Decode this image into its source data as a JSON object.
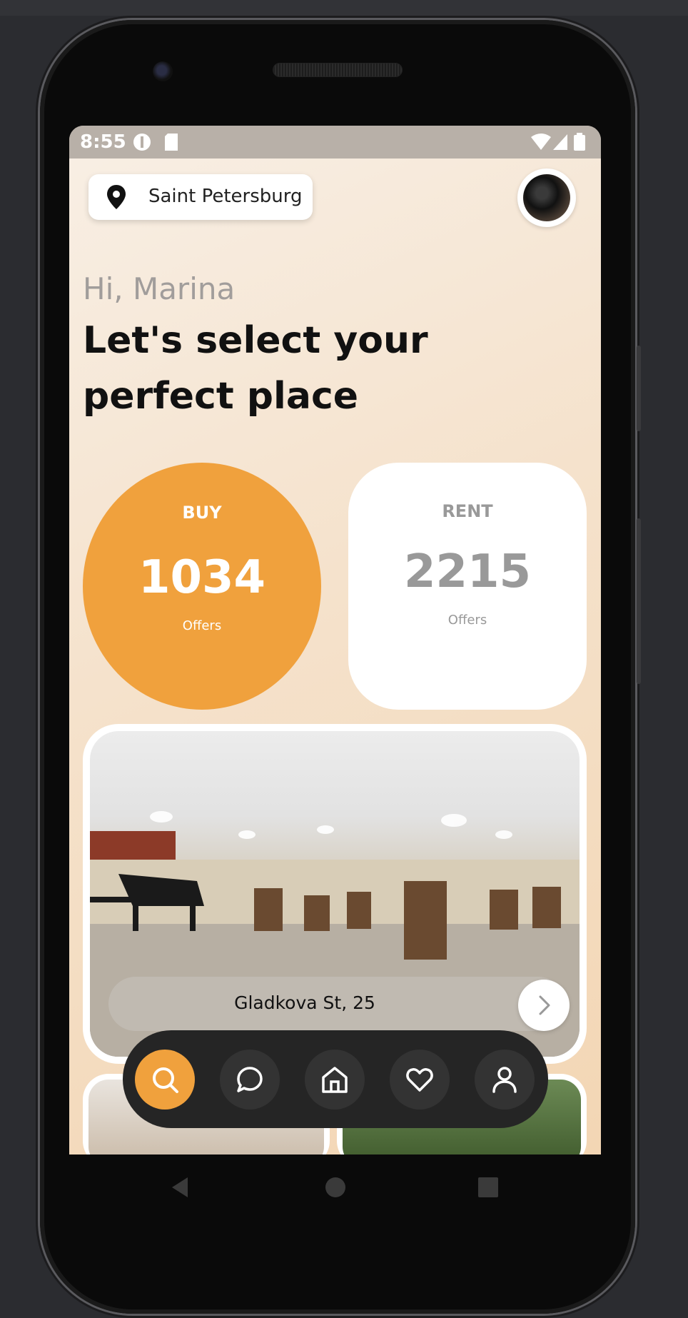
{
  "status_bar": {
    "time": "8:55"
  },
  "location": {
    "city": "Saint Petersburg"
  },
  "greeting": {
    "hello": "Hi, Marina",
    "headline": "Let's select your perfect place"
  },
  "cards": {
    "buy": {
      "label": "BUY",
      "count": "1034",
      "sub": "Offers"
    },
    "rent": {
      "label": "RENT",
      "count": "2215",
      "sub": "Offers"
    }
  },
  "listing": {
    "address": "Gladkova St, 25"
  },
  "bottom_nav": [
    {
      "name": "search-icon",
      "active": true
    },
    {
      "name": "chat-icon",
      "active": false
    },
    {
      "name": "home-icon",
      "active": false
    },
    {
      "name": "heart-icon",
      "active": false
    },
    {
      "name": "profile-icon",
      "active": false
    }
  ],
  "colors": {
    "accent": "#f0a13d",
    "nav_bg": "#252525"
  }
}
